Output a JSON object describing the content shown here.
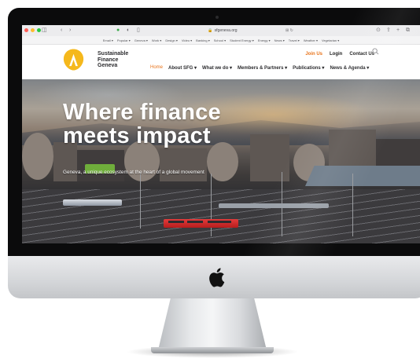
{
  "browser": {
    "url": "sfgeneva.org",
    "tab_buttons": [
      "◫",
      "‹",
      "›"
    ],
    "toolbar_right": [
      "⊙",
      "⇪",
      "+",
      "⧉"
    ],
    "bookmarks": [
      "Email ▾",
      "Popular ▾",
      "Geneva ▾",
      "Work ▾",
      "Design ▾",
      "Video ▾",
      "Banking ▾",
      "School ▾",
      "Student Energy ▾",
      "Energy ▾",
      "News ▾",
      "Travel ▾",
      "Weather ▾",
      "Vegetarian ▾"
    ]
  },
  "site": {
    "logo_lines": [
      "Sustainable",
      "Finance",
      "Geneva"
    ],
    "utility_nav": {
      "join": "Join Us",
      "login": "Login",
      "contact": "Contact Us"
    },
    "main_nav": [
      "Home",
      "About SFG ▾",
      "What we do ▾",
      "Members & Partners ▾",
      "Publications ▾",
      "News & Agenda ▾"
    ],
    "hero": {
      "headline_line1": "Where finance",
      "headline_line2": "meets impact",
      "subtitle": "Geneva, a unique ecosystem at the heart of a global movement"
    }
  },
  "colors": {
    "accent_orange": "#e8731a",
    "logo_yellow": "#f5b81c",
    "bezel": "#0b0b0c",
    "aluminium": "#d4d6d9"
  },
  "icons": {
    "search": "search-icon",
    "apple": "apple-logo",
    "logo": "sfg-logo-icon"
  }
}
